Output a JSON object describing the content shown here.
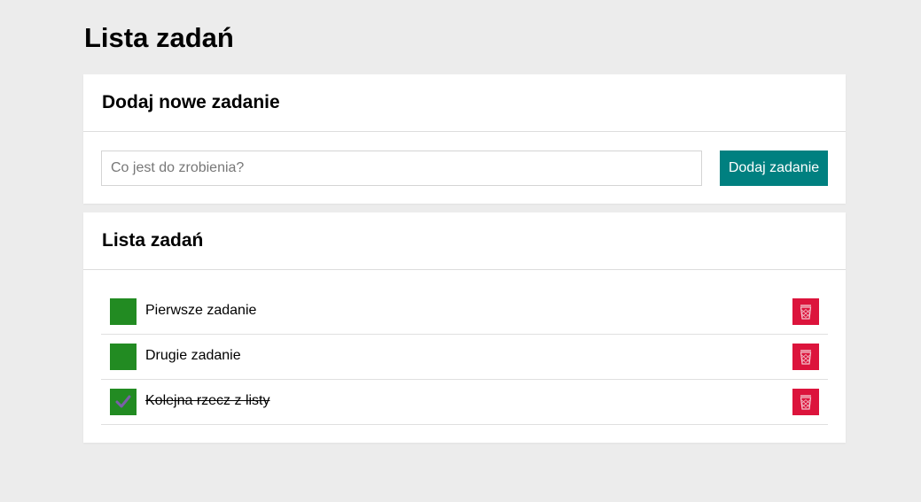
{
  "page": {
    "title": "Lista zadań"
  },
  "add_section": {
    "heading": "Dodaj nowe zadanie",
    "input_placeholder": "Co jest do zrobienia?",
    "input_value": "",
    "button_label": "Dodaj zadanie"
  },
  "list_section": {
    "heading": "Lista zadań",
    "tasks": [
      {
        "text": "Pierwsze zadanie",
        "done": false
      },
      {
        "text": "Drugie zadanie",
        "done": false
      },
      {
        "text": "Kolejna rzecz z listy",
        "done": true
      }
    ]
  },
  "colors": {
    "background": "#ececec",
    "accent": "#008080",
    "check": "#228b22",
    "delete": "#dc143c",
    "checkmark": "#7a5fa8"
  },
  "icons": {
    "checkbox": "checkmark-icon",
    "delete": "trash-icon"
  }
}
